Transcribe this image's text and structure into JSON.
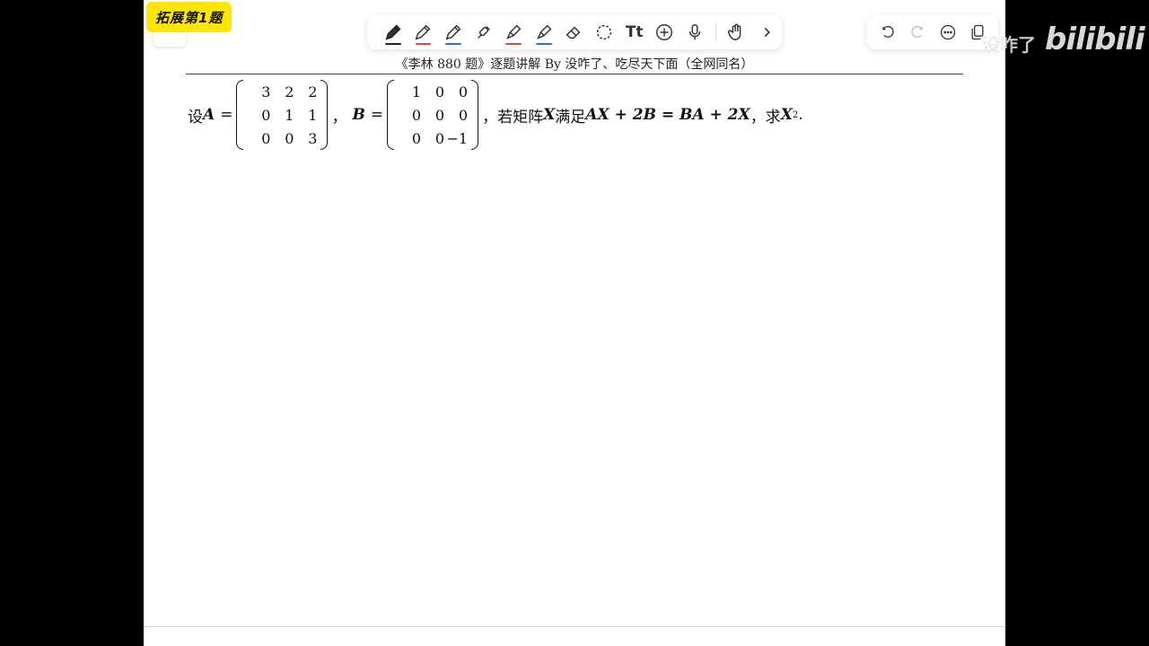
{
  "badge": {
    "label": "拓展第1题"
  },
  "header": {
    "text": "《李林 880 题》逐题讲解 By 没咋了、吃尽天下面（全网同名）"
  },
  "problem": {
    "prefix": "设",
    "a_label": "A",
    "eq": "=",
    "matrix_a": [
      "3",
      "2",
      "2",
      "0",
      "1",
      "1",
      "0",
      "0",
      "3"
    ],
    "comma": "，",
    "b_label": "B",
    "matrix_b": [
      "1",
      "0",
      "0",
      "0",
      "0",
      "0",
      "0",
      "0",
      "−1"
    ],
    "cond_text": "，若矩阵",
    "x_label": "X",
    "satisfy": "满足",
    "equation": "AX + 2B = BA + 2X",
    "ask": "，求",
    "target": "X",
    "target_exp": "2",
    "end": "."
  },
  "toolbar": {
    "tools": [
      "pencil-tool",
      "pen-red-tool",
      "pen-blue-tool",
      "pen-brush-tool",
      "highlighter-red-tool",
      "highlighter-blue-tool",
      "eraser-tool",
      "lasso-tool",
      "text-tool",
      "add-tool",
      "mic-tool",
      "hand-tool",
      "more-tools"
    ],
    "text_tool_label": "Tt"
  },
  "watermark": {
    "text": "没咋了",
    "logo": "bilibili"
  },
  "colors": {
    "badge": "#ffe600",
    "pen_red": "#d9453f",
    "pen_blue": "#2a6fd6"
  }
}
